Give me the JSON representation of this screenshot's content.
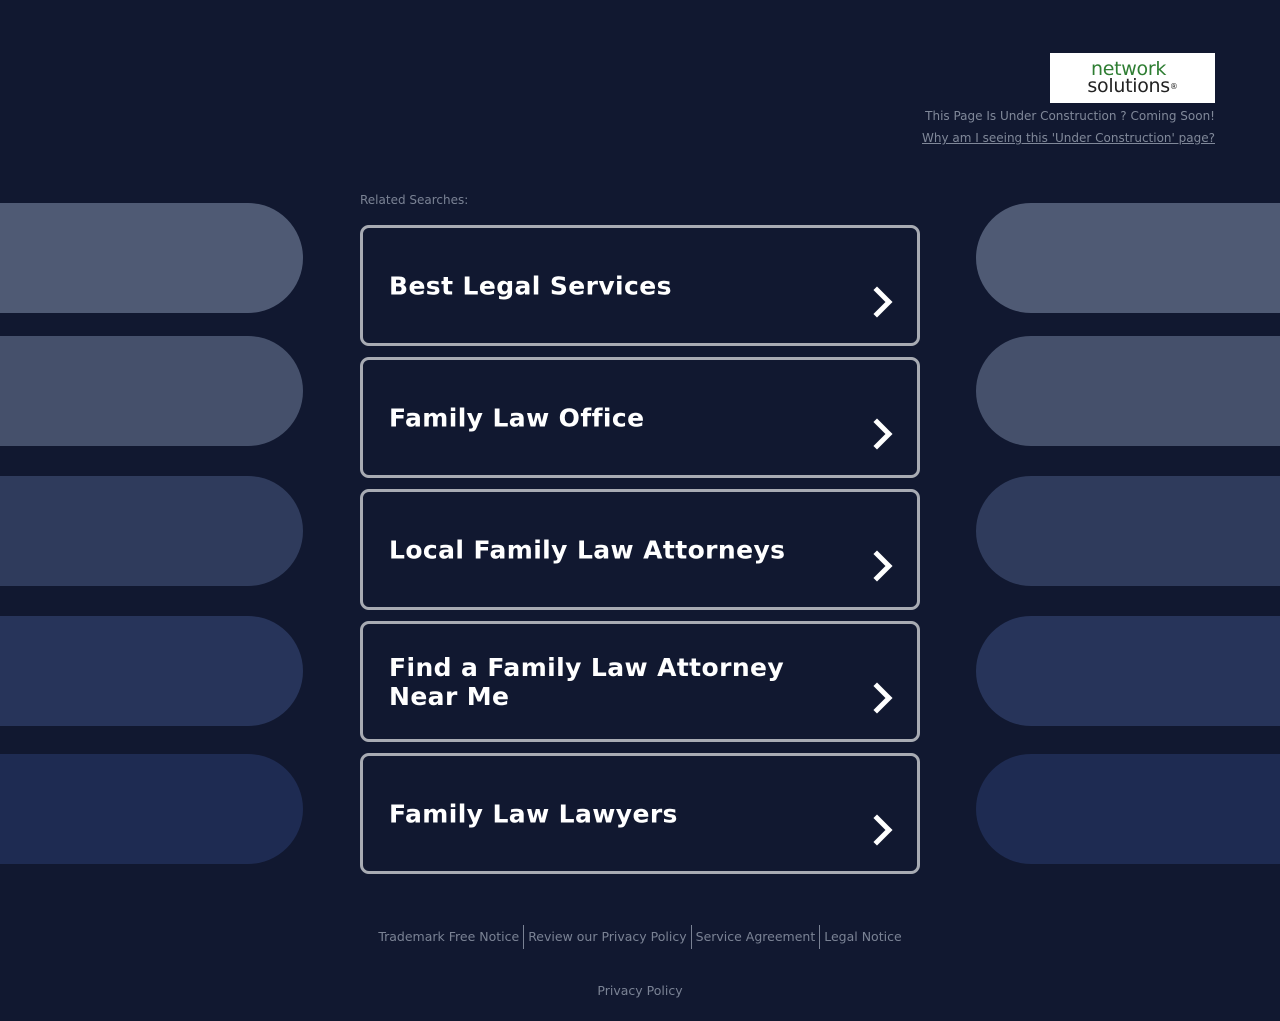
{
  "colors": {
    "background": "#111830",
    "card_border": "#a8abb3",
    "pill_colors": [
      "#4f5a74",
      "#45506b",
      "#2f3b5c",
      "#27345a",
      "#1e2b52"
    ]
  },
  "logo": {
    "line1": "network",
    "line2": "solutions",
    "registered": "®"
  },
  "header": {
    "under_construction": "This Page Is Under Construction ? Coming Soon!",
    "why_link": "Why am I seeing this 'Under Construction' page?"
  },
  "related": {
    "heading": "Related Searches:",
    "items": [
      {
        "label": "Best Legal Services",
        "icon": "chevron-right-icon"
      },
      {
        "label": "Family Law Office",
        "icon": "chevron-right-icon"
      },
      {
        "label": "Local Family Law Attorneys",
        "icon": "chevron-right-icon"
      },
      {
        "label": "Find a Family Law Attorney Near Me",
        "icon": "chevron-right-icon"
      },
      {
        "label": "Family Law Lawyers",
        "icon": "chevron-right-icon"
      }
    ]
  },
  "footer": {
    "links": [
      "Trademark Free Notice",
      "Review our Privacy Policy",
      "Service Agreement",
      "Legal Notice"
    ],
    "privacy": "Privacy Policy"
  }
}
